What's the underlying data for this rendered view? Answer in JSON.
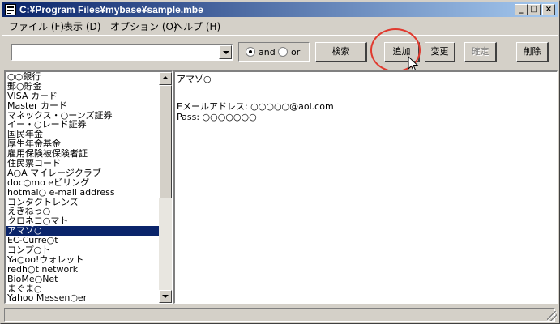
{
  "window": {
    "title": "C:¥Program Files¥mybase¥sample.mbe",
    "controls": {
      "minimize": "_",
      "maximize": "□",
      "close": "×"
    }
  },
  "menu": [
    {
      "label": "ファイル (F)"
    },
    {
      "label": "表示 (D)"
    },
    {
      "label": "オプション (O)"
    },
    {
      "label": "ヘルプ (H)"
    }
  ],
  "toolbar": {
    "search_value": "",
    "radio_and": "and",
    "radio_or": "or",
    "search_button": "検索",
    "add_button": "追加",
    "change_button": "変更",
    "confirm_button": "確定",
    "delete_button": "削除"
  },
  "list": {
    "items": [
      "○○銀行",
      "郵○貯金",
      "VISA カード",
      "Master カード",
      "マネックス・○ーンズ証券",
      "イー・○レード証券",
      "国民年金",
      "厚生年金基金",
      "雇用保険被保険者証",
      "住民票コード",
      "A○A マイレージクラブ",
      "doc○mo eビリング",
      "hotmai○ e-mail address",
      "コンタクトレンズ",
      "えきねっ○",
      "クロネコ○マト",
      "アマゾ○",
      "EC-Curre○t",
      "コンプ○ト",
      "Ya○oo!ウォレット",
      "redh○t network",
      "BioMe○Net",
      "まぐま○",
      "Yahoo Messen○er"
    ],
    "selected_index": 16
  },
  "detail": {
    "title": "アマゾ○",
    "email_line": "Eメールアドレス: ○○○○○@aol.com",
    "pass_line": "Pass: ○○○○○○○"
  },
  "colors": {
    "selection": "#0a246a",
    "annotation": "#e03a2f",
    "face": "#d4d0c8"
  }
}
